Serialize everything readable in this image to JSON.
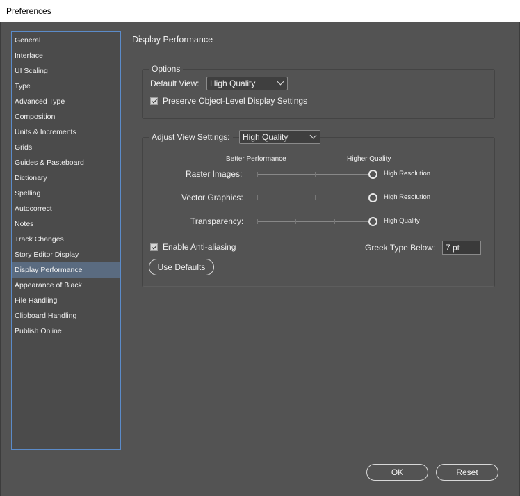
{
  "window": {
    "title": "Preferences"
  },
  "sidebar": {
    "items": [
      {
        "label": "General"
      },
      {
        "label": "Interface"
      },
      {
        "label": "UI Scaling"
      },
      {
        "label": "Type"
      },
      {
        "label": "Advanced Type"
      },
      {
        "label": "Composition"
      },
      {
        "label": "Units & Increments"
      },
      {
        "label": "Grids"
      },
      {
        "label": "Guides & Pasteboard"
      },
      {
        "label": "Dictionary"
      },
      {
        "label": "Spelling"
      },
      {
        "label": "Autocorrect"
      },
      {
        "label": "Notes"
      },
      {
        "label": "Track Changes"
      },
      {
        "label": "Story Editor Display"
      },
      {
        "label": "Display Performance",
        "selected": true
      },
      {
        "label": "Appearance of Black"
      },
      {
        "label": "File Handling"
      },
      {
        "label": "Clipboard Handling"
      },
      {
        "label": "Publish Online"
      }
    ]
  },
  "page": {
    "title": "Display Performance"
  },
  "options": {
    "legend": "Options",
    "default_view_label": "Default View:",
    "default_view_value": "High Quality",
    "preserve_label": "Preserve Object-Level Display Settings",
    "preserve_checked": true
  },
  "adjust": {
    "label": "Adjust View Settings:",
    "value": "High Quality",
    "better_performance": "Better Performance",
    "higher_quality": "Higher Quality",
    "sliders": [
      {
        "label": "Raster Images:",
        "value_text": "High Resolution",
        "level": 1.0
      },
      {
        "label": "Vector Graphics:",
        "value_text": "High Resolution",
        "level": 1.0
      },
      {
        "label": "Transparency:",
        "value_text": "High Quality",
        "level": 1.0
      }
    ],
    "antialias_label": "Enable Anti-aliasing",
    "antialias_checked": true,
    "greek_label": "Greek Type Below:",
    "greek_value": "7 pt",
    "use_defaults": "Use Defaults"
  },
  "footer": {
    "ok": "OK",
    "reset": "Reset"
  }
}
